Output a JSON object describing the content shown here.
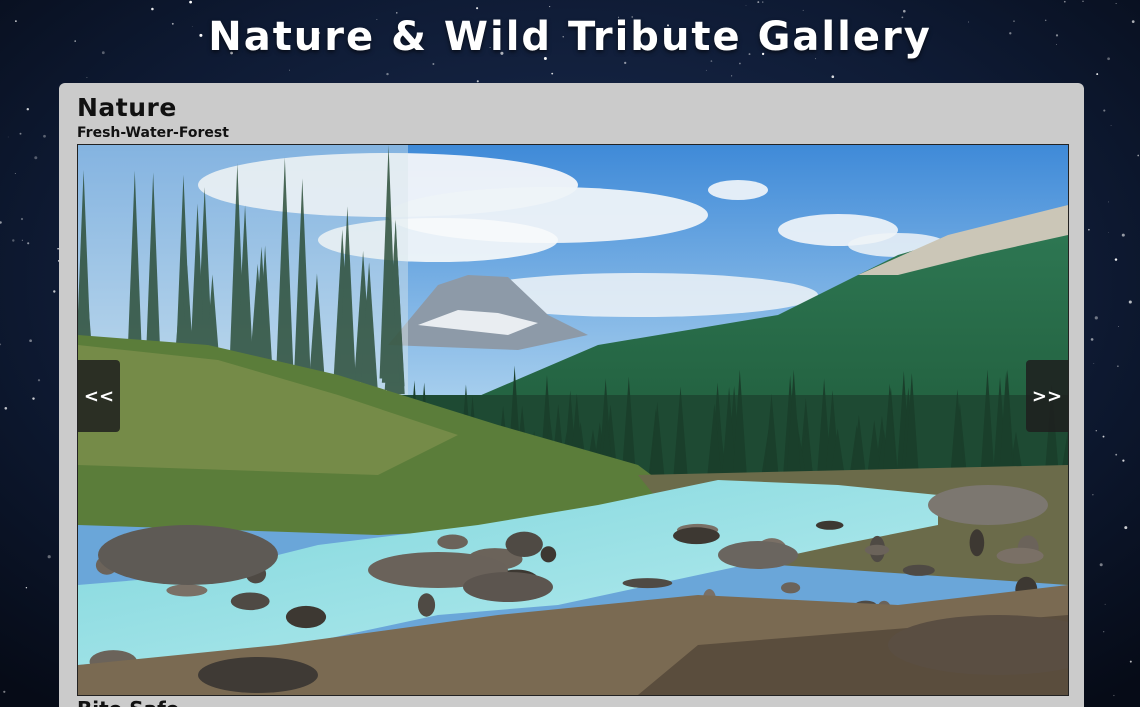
{
  "page": {
    "title": "Nature & Wild Tribute Gallery"
  },
  "gallery": {
    "heading": "Nature",
    "subheading": "Fresh-Water-Forest",
    "prev_label": "<<",
    "next_label": ">>",
    "next_caption": "Bite Safe",
    "image_name": "forest-river-landscape"
  },
  "colors": {
    "background": "#0b1426",
    "card": "#cbcbcb",
    "title_text": "#ffffff",
    "nav_button": "#1e1e1e"
  }
}
